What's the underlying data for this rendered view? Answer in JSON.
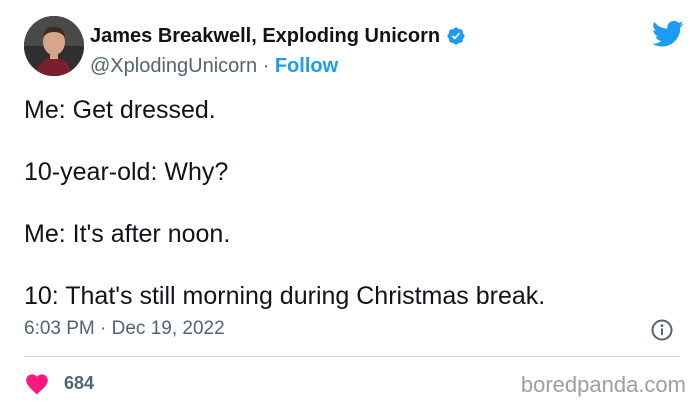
{
  "author": {
    "name": "James Breakwell, Exploding Unicorn",
    "handle": "@XplodingUnicorn",
    "separator": " · ",
    "follow_label": "Follow"
  },
  "tweet": {
    "lines": [
      "Me: Get dressed.",
      "10-year-old: Why?",
      "Me: It's after noon.",
      "10: That's still morning during Christmas break."
    ],
    "timestamp": "6:03 PM · Dec 19, 2022"
  },
  "engagement": {
    "likes": "684"
  },
  "watermark": "boredpanda.com",
  "colors": {
    "accent": "#1d9bf0",
    "like": "#f91880",
    "text": "#0f1419",
    "muted": "#536471"
  },
  "icons": [
    "avatar",
    "verified-badge-icon",
    "twitter-bird-icon",
    "info-icon",
    "heart-icon"
  ]
}
